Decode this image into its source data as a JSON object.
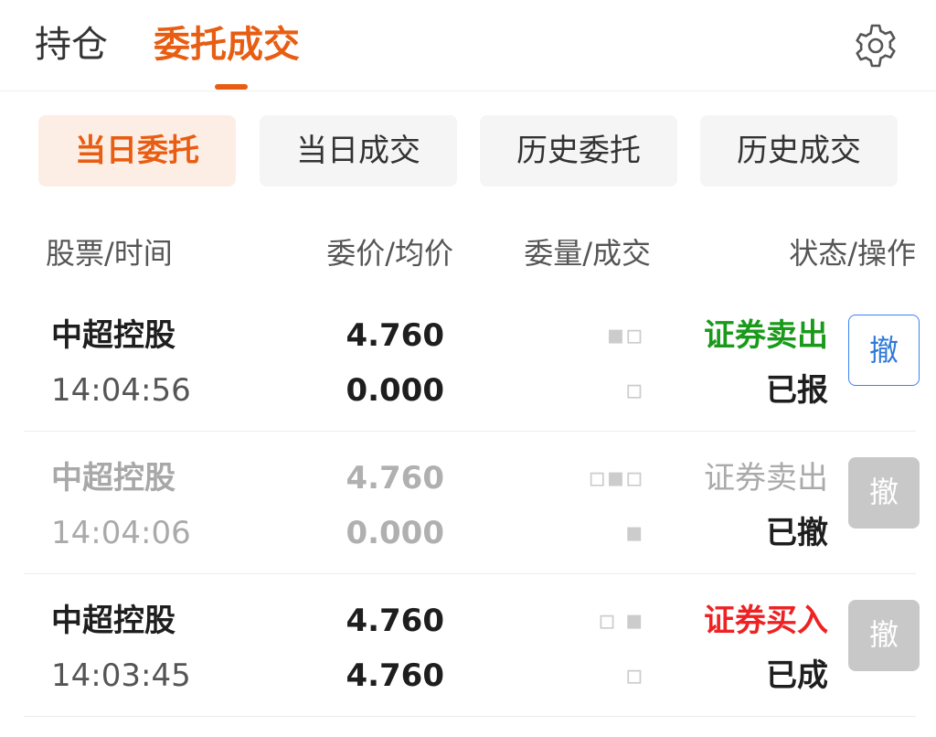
{
  "top_tabs": [
    {
      "label": "持仓",
      "active": false
    },
    {
      "label": "委托成交",
      "active": true
    }
  ],
  "settings_icon": "gear-icon",
  "sub_tabs": [
    {
      "label": "当日委托",
      "active": true
    },
    {
      "label": "当日成交",
      "active": false
    },
    {
      "label": "历史委托",
      "active": false
    },
    {
      "label": "历史成交",
      "active": false
    }
  ],
  "columns": {
    "stock_time": "股票/时间",
    "price_avg": "委价/均价",
    "qty_filled": "委量/成交",
    "status_action": "状态/操作"
  },
  "orders": [
    {
      "stock": "中超控股",
      "time": "14:04:56",
      "price": "4.760",
      "avg_price": "0.000",
      "side": "证券卖出",
      "status": "已报",
      "cancel_label": "撤",
      "cancel_enabled": true
    },
    {
      "stock": "中超控股",
      "time": "14:04:06",
      "price": "4.760",
      "avg_price": "0.000",
      "side": "证券卖出",
      "status": "已撤",
      "cancel_label": "撤",
      "cancel_enabled": false
    },
    {
      "stock": "中超控股",
      "time": "14:03:45",
      "price": "4.760",
      "avg_price": "4.760",
      "side": "证券买入",
      "status": "已成",
      "cancel_label": "撤",
      "cancel_enabled": false
    }
  ],
  "colors": {
    "accent": "#e85d12",
    "sell": "#1a9a1a",
    "buy": "#ee2222",
    "cancel_active": "#2f7ad8",
    "cancel_disabled": "#c8c8c8"
  }
}
